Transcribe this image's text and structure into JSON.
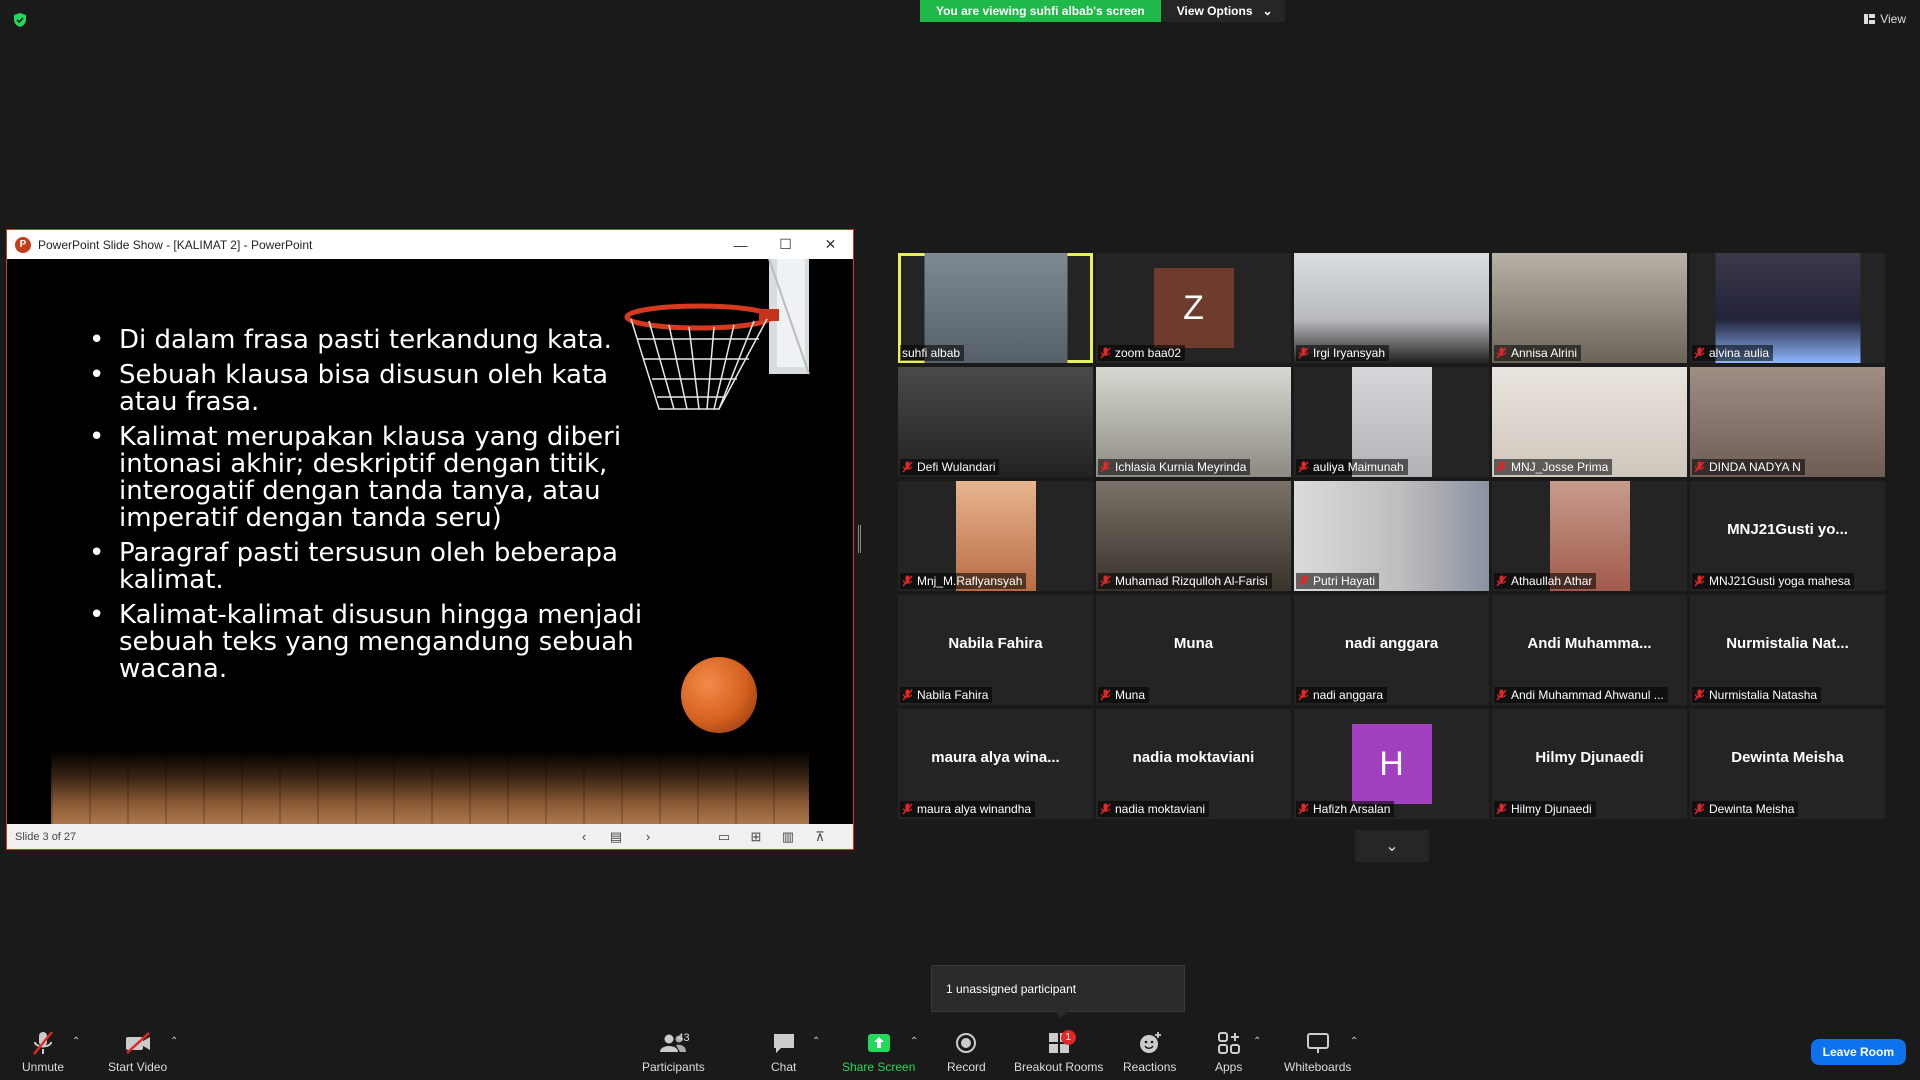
{
  "topbar": {
    "viewing_text": "You are viewing suhfi albab's screen",
    "view_options_label": "View Options",
    "view_label": "View"
  },
  "ppt": {
    "window_title": "PowerPoint Slide Show - [KALIMAT 2] - PowerPoint",
    "logo_letter": "P",
    "bullets": [
      "Di dalam frasa pasti terkandung kata.",
      "Sebuah klausa bisa disusun oleh kata atau frasa.",
      "Kalimat merupakan klausa yang diberi intonasi akhir; deskriptif dengan titik, interogatif dengan tanda tanya, atau imperatif dengan tanda seru)",
      "Paragraf pasti tersusun oleh beberapa kalimat.",
      "Kalimat-kalimat disusun hingga menjadi sebuah teks yang mengandung sebuah wacana."
    ],
    "status": "Slide 3 of 27"
  },
  "participants_tiles": [
    {
      "name": "suhfi albab",
      "muted": false
    },
    {
      "name": "zoom baa02",
      "muted": true,
      "avatar": "Z",
      "avatar_color": "#6e3b2c"
    },
    {
      "name": "Irgi Iryansyah",
      "muted": true
    },
    {
      "name": "Annisa Alrini",
      "muted": true
    },
    {
      "name": "alvina aulia",
      "muted": true
    },
    {
      "name": "Defi Wulandari",
      "muted": true
    },
    {
      "name": "Ichlasia Kurnia Meyrinda",
      "muted": true
    },
    {
      "name": "auliya Maimunah",
      "muted": true
    },
    {
      "name": "MNJ_Josse Prima",
      "muted": true
    },
    {
      "name": "DINDA NADYA N",
      "muted": true
    },
    {
      "name": "Mnj_M.Raflyansyah",
      "muted": true
    },
    {
      "name": "Muhamad Rizqulloh Al-Farisi",
      "muted": true
    },
    {
      "name": "Putri Hayati",
      "muted": true
    },
    {
      "name": "Athaullah Athar",
      "muted": true
    },
    {
      "name": "MNJ21Gusti yoga mahesa",
      "muted": true,
      "display": "MNJ21Gusti yo..."
    },
    {
      "name": "Nabila Fahira",
      "muted": true,
      "display": "Nabila Fahira"
    },
    {
      "name": "Muna",
      "muted": true,
      "display": "Muna"
    },
    {
      "name": "nadi anggara",
      "muted": true,
      "display": "nadi anggara"
    },
    {
      "name": "Andi Muhammad Ahwanul ...",
      "muted": true,
      "display": "Andi  Muhamma..."
    },
    {
      "name": "Nurmistalia Natasha",
      "muted": true,
      "display": "Nurmistalia  Nat..."
    },
    {
      "name": "maura alya winandha",
      "muted": true,
      "display": "maura  alya  wina..."
    },
    {
      "name": "nadia moktaviani",
      "muted": true,
      "display": "nadia moktaviani"
    },
    {
      "name": "Hafizh Arsalan",
      "muted": true,
      "avatar": "H",
      "avatar_color": "#a23fbf"
    },
    {
      "name": "Hilmy Djunaedi",
      "muted": true,
      "display": "Hilmy Djunaedi"
    },
    {
      "name": "Dewinta Meisha",
      "muted": true,
      "display": "Dewinta Meisha"
    }
  ],
  "tooltip": "1 unassigned participant",
  "toolbar": {
    "unmute": "Unmute",
    "start_video": "Start Video",
    "participants": "Participants",
    "participants_count": "43",
    "chat": "Chat",
    "share_screen": "Share Screen",
    "record": "Record",
    "breakout_rooms": "Breakout Rooms",
    "breakout_badge": "1",
    "reactions": "Reactions",
    "apps": "Apps",
    "whiteboards": "Whiteboards",
    "leave_room": "Leave Room"
  },
  "colors": {
    "accent_green": "#1fb94a",
    "active_speaker": "#e8f05a",
    "leave_blue": "#0e72ed",
    "mute_red": "#e02828"
  }
}
